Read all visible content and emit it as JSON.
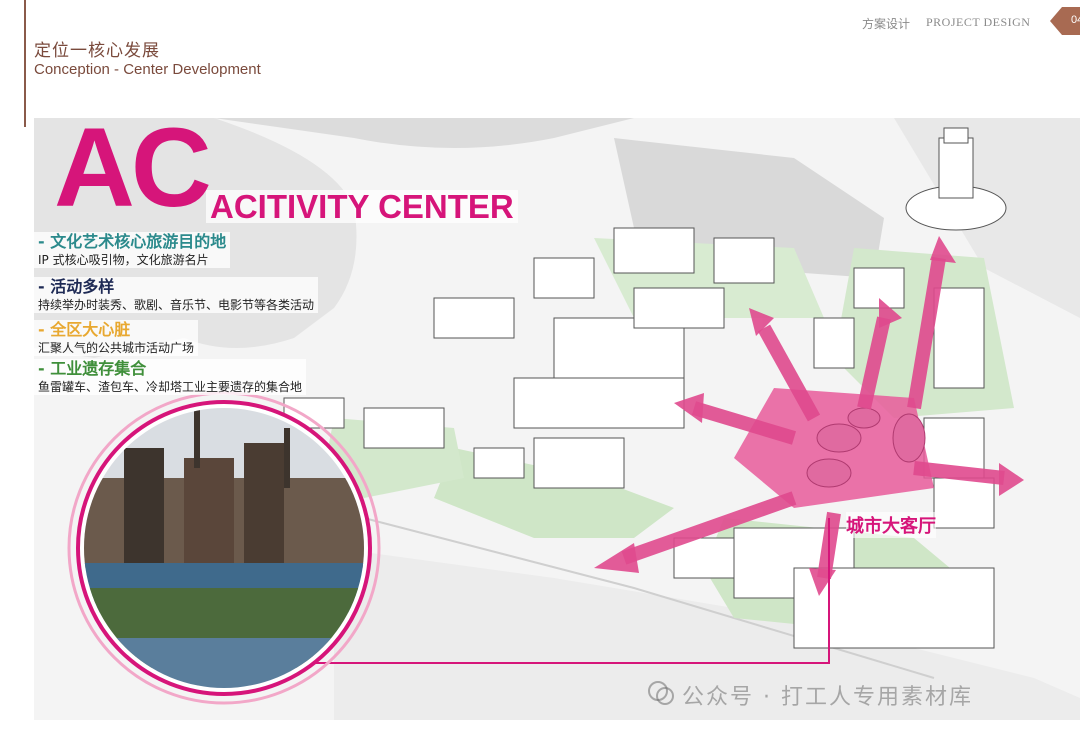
{
  "header": {
    "title_cn": "定位一核心发展",
    "title_en": "Conception - Center Development",
    "section_cn": "方案设计",
    "section_en": "PROJECT DESIGN",
    "page_number": "04"
  },
  "hero": {
    "big_letters": "AC",
    "subtitle": "ACITIVITY CENTER"
  },
  "features": [
    {
      "title": "- 文化艺术核心旅游目的地",
      "desc": "IP 式核心吸引物，文化旅游名片",
      "color": "#2b8a8c"
    },
    {
      "title": "- 活动多样",
      "desc": "持续举办时装秀、歌剧、音乐节、电影节等各类活动",
      "color": "#1e2a55"
    },
    {
      "title": "- 全区大心脏",
      "desc": "汇聚人气的公共城市活动广场",
      "color": "#e8a830"
    },
    {
      "title": "- 工业遗存集合",
      "desc": "鱼雷罐车、渣包车、冷却塔工业主要遗存的集合地",
      "color": "#3f8f3a"
    }
  ],
  "map": {
    "hub_label": "城市大客厅",
    "accent_color": "#d6157a",
    "icons": [
      "industrial-photo",
      "arrow-icon",
      "cooling-tower-icon"
    ]
  },
  "watermark": "公众号 · 打工人专用素材库"
}
